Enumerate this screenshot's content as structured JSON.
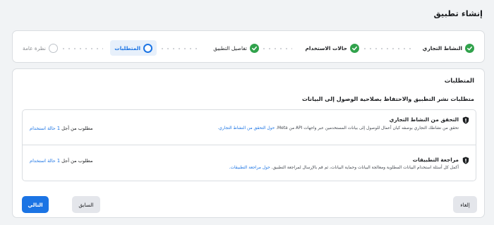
{
  "page": {
    "title": "إنشاء تطبيق"
  },
  "stepper": {
    "steps": [
      {
        "label": "النشاط التجاري",
        "state": "done",
        "icon": "checkmark-icon"
      },
      {
        "label": "حالات الاستخدام",
        "state": "done",
        "icon": "checkmark-icon"
      },
      {
        "label": "تفاصيل التطبيق",
        "state": "done",
        "icon": "checkmark-icon"
      },
      {
        "label": "المتطلبات",
        "state": "current",
        "icon": "current-step-icon"
      },
      {
        "label": "نظرة عامة",
        "state": "pending",
        "icon": "pending-step-icon"
      }
    ]
  },
  "requirements": {
    "title": "المتطلبات",
    "subtitle": "متطلبات نشر التطبيق والاحتفاظ بصلاحية الوصول إلى البيانات",
    "items": [
      {
        "title": "التحقق من النشاط التجاري",
        "description": "تحقق من نشاطك التجاري بوصفه كيان أعمال للوصول إلى بيانات المستخدمين عبر واجهات API من Meta.",
        "link": "حول التحقق من النشاط التجاري.",
        "needed_prefix": "مطلوب من أجل",
        "needed_count": "1",
        "needed_link": "حالة استخدام",
        "icon": "shield-icon"
      },
      {
        "title": "مراجعة التطبيقات",
        "description": "أكمل كل أسئلة استخدام البيانات المطلوبة ومعالجة البيانات وحماية البيانات، ثم قم بالإرسال لمراجعة التطبيق.",
        "link": "حول مراجعة التطبيقات.",
        "needed_prefix": "مطلوب من أجل",
        "needed_count": "1",
        "needed_link": "حالة استخدام",
        "icon": "shield-icon"
      }
    ]
  },
  "buttons": {
    "cancel": "إلغاء",
    "previous": "السابق",
    "next": "التالي"
  },
  "colors": {
    "accent": "#1b74e4",
    "success": "#31a24c",
    "background": "#f1f3f5"
  }
}
